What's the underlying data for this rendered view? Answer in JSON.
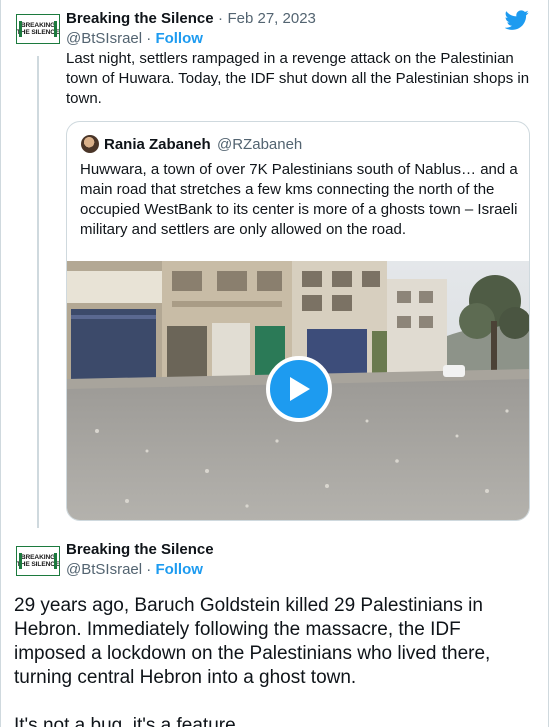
{
  "tweet1": {
    "author_name": "Breaking the Silence",
    "separator": "·",
    "date": "Feb 27, 2023",
    "handle": "@BtSIsrael",
    "follow_label": "Follow",
    "text": "Last night, settlers rampaged in a revenge attack on the Palestinian town of Huwara. Today, the IDF shut down all the Palestinian shops in town.",
    "avatar_text_line1": "BREAKING",
    "avatar_text_line2": "THE SILENCE"
  },
  "quoted": {
    "author_name": "Rania Zabaneh",
    "handle": "@RZabaneh",
    "text": "Huwwara, a town of over 7K Palestinians south of Nablus… and a main road that stretches a few kms connecting the north of the occupied WestBank to its center is more of a ghosts town – Israeli military and settlers are only allowed on the road.",
    "media_type": "video"
  },
  "tweet2": {
    "author_name": "Breaking the Silence",
    "handle": "@BtSIsrael",
    "follow_label": "Follow",
    "text": "29 years ago, Baruch Goldstein killed 29 Palestinians in Hebron. Immediately following the massacre, the IDF imposed a lockdown on the Palestinians who lived there, turning central Hebron into a ghost town.",
    "text_cut": "It's not a bug, it's a feature.",
    "avatar_text_line1": "BREAKING",
    "avatar_text_line2": "THE SILENCE"
  },
  "icons": {
    "brand": "twitter-bird-icon",
    "play": "play-icon"
  },
  "colors": {
    "accent": "#1d9bf0",
    "text": "#0f1419",
    "secondary": "#536471",
    "border": "#cfd9de",
    "logo_green": "#1c7a3e"
  }
}
